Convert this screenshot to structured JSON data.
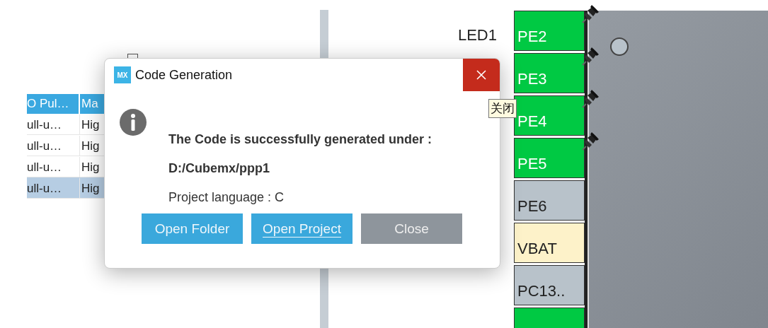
{
  "checkbox": {
    "checked": false
  },
  "table": {
    "columns": [
      "O Pul…",
      "Ma"
    ],
    "rows": [
      {
        "cells": [
          "ull-u…",
          "Hig"
        ],
        "selected": false
      },
      {
        "cells": [
          "ull-u…",
          "Hig"
        ],
        "selected": false
      },
      {
        "cells": [
          "ull-u…",
          "Hig"
        ],
        "selected": false
      },
      {
        "cells": [
          "ull-u…",
          "Hig"
        ],
        "selected": true
      }
    ]
  },
  "pin_labels": [
    {
      "text": "LED1"
    }
  ],
  "pins": [
    {
      "label": "PE2",
      "kind": "gpio",
      "pinned": true
    },
    {
      "label": "PE3",
      "kind": "gpio",
      "pinned": true
    },
    {
      "label": "PE4",
      "kind": "gpio",
      "pinned": true
    },
    {
      "label": "PE5",
      "kind": "gpio",
      "pinned": true
    },
    {
      "label": "PE6",
      "kind": "unused",
      "pinned": false
    },
    {
      "label": "VBAT",
      "kind": "power",
      "pinned": false
    },
    {
      "label": "PC13..",
      "kind": "unused",
      "pinned": false
    },
    {
      "kind": "gpio",
      "pinned": false
    }
  ],
  "dialog": {
    "title": "Code Generation",
    "logo": "MX",
    "message": "The Code is successfully generated under :",
    "path": "D:/Cubemx/ppp1",
    "language": "Project language : C",
    "buttons": [
      {
        "label": "Open Folder",
        "kind": "primary",
        "focused": false
      },
      {
        "label": "Open Project",
        "kind": "primary",
        "focused": true
      },
      {
        "label": "Close",
        "kind": "secondary",
        "focused": false
      }
    ],
    "close_tooltip": "关闭"
  }
}
